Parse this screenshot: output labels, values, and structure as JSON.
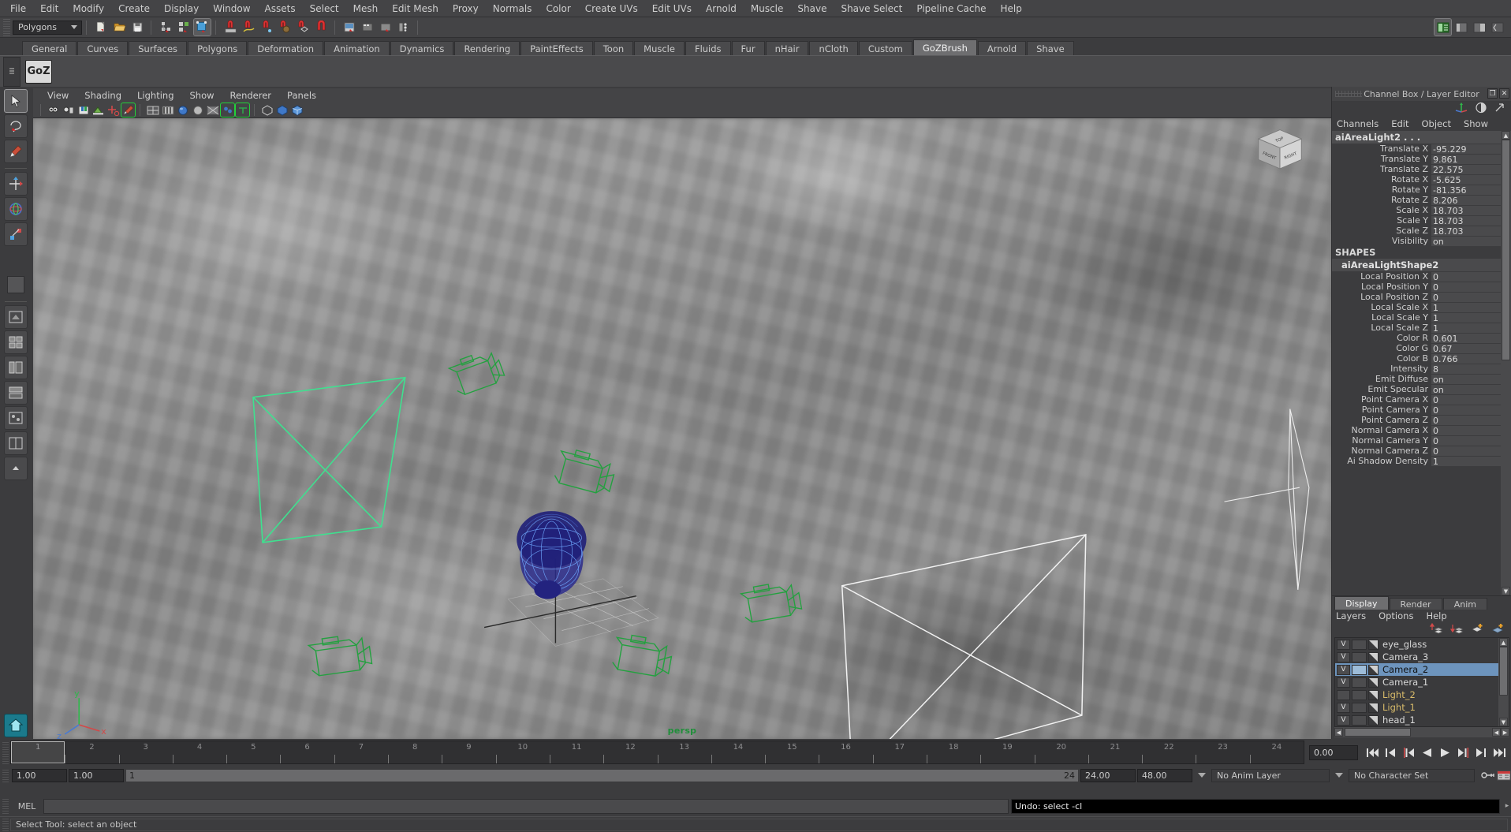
{
  "menubar": {
    "items": [
      "File",
      "Edit",
      "Modify",
      "Create",
      "Display",
      "Window",
      "Assets",
      "Select",
      "Mesh",
      "Edit Mesh",
      "Proxy",
      "Normals",
      "Color",
      "Create UVs",
      "Edit UVs",
      "Arnold",
      "Muscle",
      "Shave",
      "Shave Select",
      "Pipeline Cache",
      "Help"
    ]
  },
  "statusbar": {
    "mode_selector": "Polygons",
    "icons": [
      "new-scene-icon",
      "open-scene-icon",
      "save-scene-icon",
      "select-by-hierarchy-icon",
      "select-by-object-icon",
      "select-by-component-icon",
      "snap-to-grid-icon",
      "snap-to-curve-icon",
      "snap-to-point-icon",
      "snap-to-projected-center-icon",
      "snap-to-view-plane-icon",
      "magnet-icon",
      "render-view-icon",
      "render-current-frame-icon",
      "ipr-render-icon",
      "render-settings-icon"
    ],
    "right_icons": [
      "show-hide-attribute-editor-icon",
      "show-hide-tool-settings-icon",
      "show-hide-channel-box-icon",
      "sidebar-collapse-icon"
    ]
  },
  "shelf": {
    "tabs": [
      "General",
      "Curves",
      "Surfaces",
      "Polygons",
      "Deformation",
      "Animation",
      "Dynamics",
      "Rendering",
      "PaintEffects",
      "Toon",
      "Muscle",
      "Fluids",
      "Fur",
      "nHair",
      "nCloth",
      "Custom",
      "GoZBrush",
      "Arnold",
      "Shave"
    ],
    "active_tab": "GoZBrush",
    "buttons": [
      {
        "label": "GoZ",
        "name": "goz-button"
      }
    ]
  },
  "toolbox": {
    "items": [
      {
        "name": "select-tool",
        "icon": "arrow-cursor-icon"
      },
      {
        "name": "lasso-select-tool",
        "icon": "lasso-icon"
      },
      {
        "name": "paint-select-tool",
        "icon": "paint-brush-icon"
      },
      {
        "name": "move-tool",
        "icon": "move-arrows-icon"
      },
      {
        "name": "rotate-tool",
        "icon": "rotate-circle-icon"
      },
      {
        "name": "scale-tool",
        "icon": "scale-box-icon"
      },
      {
        "name": "last-tool-used",
        "icon": "blank-tool-icon"
      },
      {
        "name": "quick-layout-single-perspective",
        "icon": "layout-single-icon"
      },
      {
        "name": "quick-layout-four-view",
        "icon": "layout-four-view-icon"
      },
      {
        "name": "quick-layout-persp-outliner",
        "icon": "layout-persp-outliner-icon"
      },
      {
        "name": "quick-layout-persp-graph",
        "icon": "layout-persp-graph-icon"
      },
      {
        "name": "quick-layout-hypershade",
        "icon": "layout-hypershade-icon"
      },
      {
        "name": "quick-layout-persp-side",
        "icon": "layout-persp-side-icon"
      },
      {
        "name": "quick-layout-more",
        "icon": "layout-more-icon"
      },
      {
        "name": "home-layout-button",
        "icon": "home-icon"
      }
    ]
  },
  "viewport": {
    "panel_menus": [
      "View",
      "Shading",
      "Lighting",
      "Show",
      "Renderer",
      "Panels"
    ],
    "toolbar_icons": [
      "select-camera-icon",
      "camera-attributes-icon",
      "bookmark-icon",
      "image-plane-icon",
      "two-d-pan-zoom-icon",
      "grease-pencil-icon",
      "wireframe-icon",
      "smooth-shade-icon",
      "hardware-texture-icon",
      "use-default-light-icon",
      "shadows-icon",
      "xray-icon",
      "xray-joints-icon",
      "text-overlay-icon",
      "iso-box-icon",
      "shaded-box-icon",
      "textured-box-icon"
    ],
    "camera_label": "persp",
    "view_cube_faces": [
      "TOP",
      "FRONT",
      "RIGHT"
    ],
    "axis_labels": [
      "y",
      "x",
      "z"
    ]
  },
  "channelbox": {
    "title": "Channel Box / Layer Editor",
    "tabs": [
      "Channels",
      "Edit",
      "Object",
      "Show"
    ],
    "node_name": "aiAreaLight2 . . .",
    "transform_channels": [
      {
        "label": "Translate X",
        "value": "-95.229"
      },
      {
        "label": "Translate Y",
        "value": "9.861"
      },
      {
        "label": "Translate Z",
        "value": "22.575"
      },
      {
        "label": "Rotate X",
        "value": "-5.625"
      },
      {
        "label": "Rotate Y",
        "value": "-81.356"
      },
      {
        "label": "Rotate Z",
        "value": "8.206"
      },
      {
        "label": "Scale X",
        "value": "18.703"
      },
      {
        "label": "Scale Y",
        "value": "18.703"
      },
      {
        "label": "Scale Z",
        "value": "18.703"
      },
      {
        "label": "Visibility",
        "value": "on"
      }
    ],
    "shapes_header": "SHAPES",
    "shape_name": "aiAreaLightShape2",
    "shape_channels": [
      {
        "label": "Local Position X",
        "value": "0"
      },
      {
        "label": "Local Position Y",
        "value": "0"
      },
      {
        "label": "Local Position Z",
        "value": "0"
      },
      {
        "label": "Local Scale X",
        "value": "1"
      },
      {
        "label": "Local Scale Y",
        "value": "1"
      },
      {
        "label": "Local Scale Z",
        "value": "1"
      },
      {
        "label": "Color R",
        "value": "0.601"
      },
      {
        "label": "Color G",
        "value": "0.67"
      },
      {
        "label": "Color B",
        "value": "0.766"
      },
      {
        "label": "Intensity",
        "value": "8"
      },
      {
        "label": "Emit Diffuse",
        "value": "on"
      },
      {
        "label": "Emit Specular",
        "value": "on"
      },
      {
        "label": "Point Camera X",
        "value": "0"
      },
      {
        "label": "Point Camera Y",
        "value": "0"
      },
      {
        "label": "Point Camera Z",
        "value": "0"
      },
      {
        "label": "Normal Camera X",
        "value": "0"
      },
      {
        "label": "Normal Camera Y",
        "value": "0"
      },
      {
        "label": "Normal Camera Z",
        "value": "0"
      },
      {
        "label": "Ai Shadow Density",
        "value": "1"
      }
    ]
  },
  "layereditor": {
    "tabs": [
      "Display",
      "Render",
      "Anim"
    ],
    "active_tab": "Display",
    "menus": [
      "Layers",
      "Options",
      "Help"
    ],
    "tool_icons": [
      "move-layer-up-icon",
      "move-layer-down-icon",
      "new-layer-icon",
      "new-layer-from-selected-icon"
    ],
    "layers": [
      {
        "visibility": "V",
        "name": "eye_glass",
        "selected": false,
        "color": "normal"
      },
      {
        "visibility": "V",
        "name": "Camera_3",
        "selected": false,
        "color": "normal"
      },
      {
        "visibility": "V",
        "name": "Camera_2",
        "selected": true,
        "color": "normal"
      },
      {
        "visibility": "V",
        "name": "Camera_1",
        "selected": false,
        "color": "normal"
      },
      {
        "visibility": "",
        "name": "Light_2",
        "selected": false,
        "color": "orange"
      },
      {
        "visibility": "V",
        "name": "Light_1",
        "selected": false,
        "color": "orange"
      },
      {
        "visibility": "V",
        "name": "head_1",
        "selected": false,
        "color": "normal"
      }
    ]
  },
  "timeslider": {
    "frames": [
      "1",
      "2",
      "3",
      "4",
      "5",
      "6",
      "7",
      "8",
      "9",
      "10",
      "11",
      "12",
      "13",
      "14",
      "15",
      "16",
      "17",
      "18",
      "19",
      "20",
      "21",
      "22",
      "23",
      "24"
    ],
    "current_frame_value": "0.00",
    "playback_buttons": [
      "go-to-start-icon",
      "step-back-keyframe-icon",
      "step-back-frame-icon",
      "play-backwards-icon",
      "play-forwards-icon",
      "step-forward-frame-icon",
      "step-forward-keyframe-icon",
      "go-to-end-icon"
    ]
  },
  "rangeslider": {
    "anim_start": "1.00",
    "range_start": "1.00",
    "bar_left_label": "1",
    "bar_right_label": "24",
    "range_end": "24.00",
    "anim_end": "48.00",
    "anim_layer": "No Anim Layer",
    "character_set": "No Character Set",
    "right_icons": [
      "auto-keyframe-icon",
      "animation-preferences-icon"
    ]
  },
  "commandline": {
    "language_label": "MEL",
    "input_value": "",
    "feedback": "Undo: select -cl"
  },
  "helpline": {
    "text": "Select Tool: select an object"
  },
  "colors": {
    "accent_green": "#3fe08f",
    "wire_green": "#1f8f3a",
    "selection_blue": "#6d94bd",
    "panel_bg": "#3c3c3e",
    "field_bg": "#2e2e30"
  }
}
